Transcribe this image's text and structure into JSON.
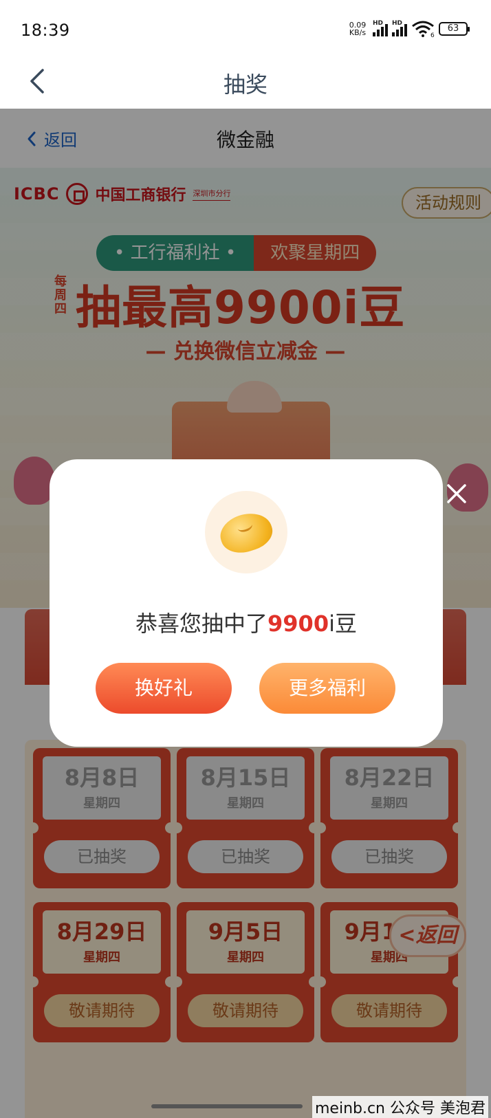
{
  "status_bar": {
    "time": "18:39",
    "net_speed_value": "0.09",
    "net_speed_unit": "KB/s",
    "signal_tag": "HD",
    "wifi_tag": "6",
    "battery": "63"
  },
  "top_nav": {
    "title": "抽奖"
  },
  "sub_nav": {
    "back_label": "返回",
    "title": "微金融"
  },
  "hero": {
    "bank_short": "ICBC",
    "bank_name": "中国工商银行",
    "branch": "深圳市分行",
    "rules_button": "活动规则",
    "pill_left": "• 工行福利社 •",
    "pill_right": "欢聚星期四",
    "weekly_tag": "每周四",
    "headline": "抽最高9900i豆",
    "subline": "— 兑换微信立减金 —"
  },
  "draws": [
    {
      "date": "8月8日",
      "weekday": "星期四",
      "button": "已抽奖",
      "state": "done"
    },
    {
      "date": "8月15日",
      "weekday": "星期四",
      "button": "已抽奖",
      "state": "done"
    },
    {
      "date": "8月22日",
      "weekday": "星期四",
      "button": "已抽奖",
      "state": "done"
    },
    {
      "date": "8月29日",
      "weekday": "星期四",
      "button": "敬请期待",
      "state": "upcoming"
    },
    {
      "date": "9月5日",
      "weekday": "星期四",
      "button": "敬请期待",
      "state": "upcoming"
    },
    {
      "date": "9月12日",
      "weekday": "星期四",
      "button": "敬请期待",
      "state": "upcoming"
    }
  ],
  "float_back": "<返回",
  "modal": {
    "prefix": "恭喜您抽中了",
    "amount": "9900",
    "suffix": "i豆",
    "btn_left": "换好礼",
    "btn_right": "更多福利"
  },
  "watermark": "meinb.cn  公众号 美泡君",
  "colors": {
    "accent_red": "#e0322a",
    "button_orange": "#ec4b2c",
    "button_light_orange": "#fb8a37",
    "link_blue": "#1e64c8"
  }
}
